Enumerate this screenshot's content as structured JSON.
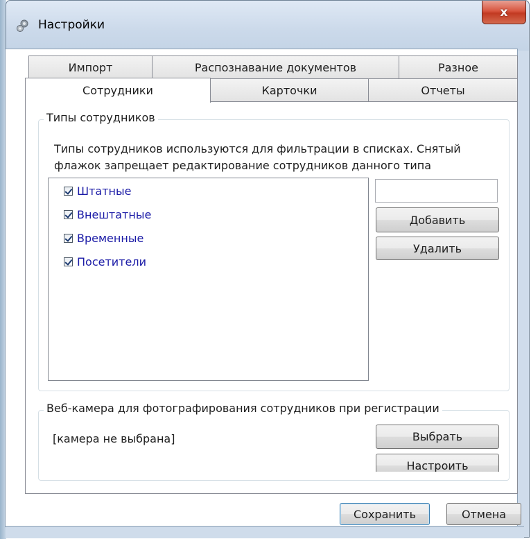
{
  "window": {
    "title": "Настройки",
    "close_glyph": "x"
  },
  "tabs_row1": [
    {
      "label": "Импорт"
    },
    {
      "label": "Распознавание документов"
    },
    {
      "label": "Разное"
    }
  ],
  "tabs_row2": [
    {
      "label": "Сотрудники",
      "active": true
    },
    {
      "label": "Карточки"
    },
    {
      "label": "Отчеты"
    }
  ],
  "employee_types": {
    "group_label": "Типы сотрудников",
    "description_line1": "Типы сотрудников используются для фильтрации в списках. Снятый",
    "description_line2": "флажок запрещает редактирование сотрудников данного типа",
    "items": [
      {
        "label": "Штатные",
        "checked": true
      },
      {
        "label": "Внештатные",
        "checked": true
      },
      {
        "label": "Временные",
        "checked": true
      },
      {
        "label": "Посетители",
        "checked": true
      }
    ],
    "new_type_value": "",
    "add_label": "Добавить",
    "delete_label": "Удалить"
  },
  "webcam": {
    "group_label": "Веб-камера для фотографирования сотрудников при регистрации",
    "status": "[камера не выбрана]",
    "choose_label": "Выбрать",
    "configure_label": "Настроить"
  },
  "footer": {
    "save_label": "Сохранить",
    "cancel_label": "Отмена"
  },
  "colors": {
    "item_text": "#1a1aa6",
    "close_button": "#c23a22",
    "frame": "#cfdceb"
  }
}
